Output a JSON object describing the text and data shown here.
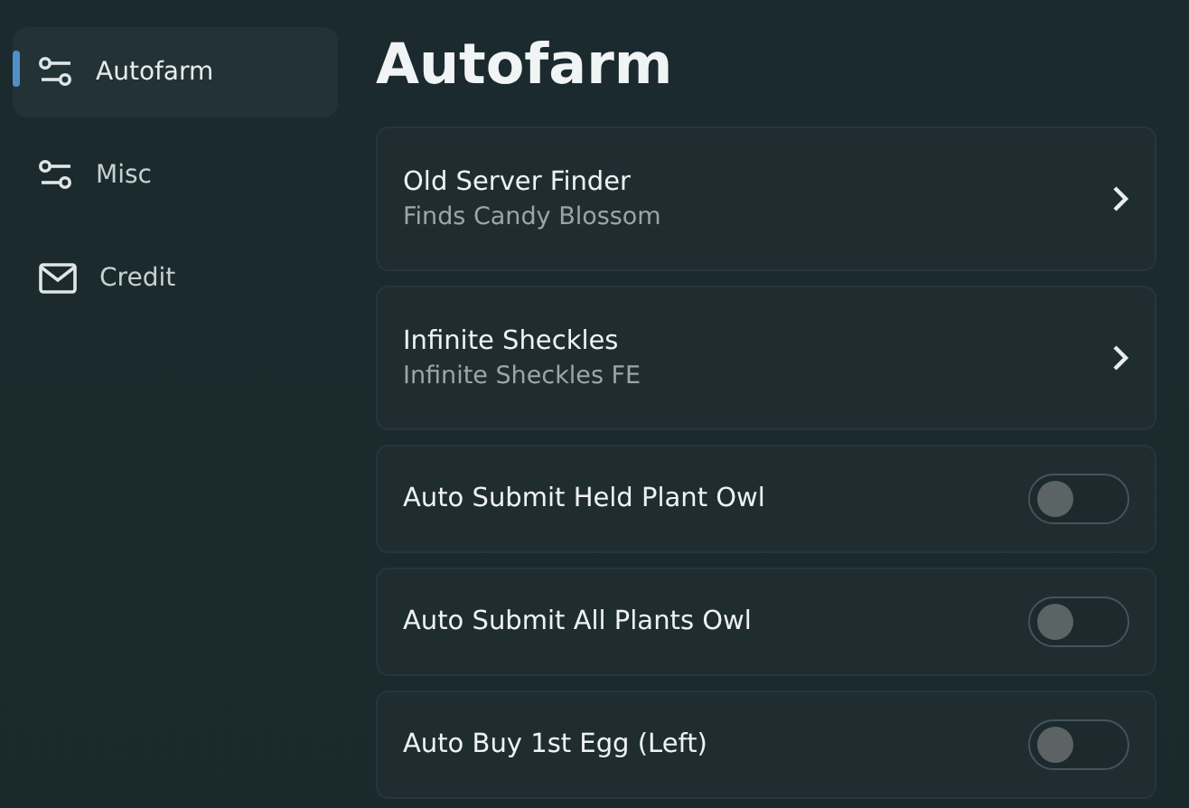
{
  "sidebar": {
    "items": [
      {
        "label": "Autofarm",
        "kind": "options",
        "selected": true
      },
      {
        "label": "Misc",
        "kind": "options",
        "selected": false
      },
      {
        "label": "Credit",
        "kind": "message",
        "selected": false
      }
    ]
  },
  "page": {
    "title": "Autofarm"
  },
  "options": [
    {
      "kind": "button",
      "title": "Old Server Finder",
      "description": "Finds Candy Blossom"
    },
    {
      "kind": "button",
      "title": "Infinite Sheckles",
      "description": "Infinite Sheckles FE"
    },
    {
      "kind": "toggle",
      "title": "Auto Submit Held Plant Owl",
      "on": false
    },
    {
      "kind": "toggle",
      "title": "Auto Submit All Plants Owl",
      "on": false
    },
    {
      "kind": "toggle",
      "title": "Auto Buy 1st Egg (Left)",
      "on": false
    }
  ]
}
